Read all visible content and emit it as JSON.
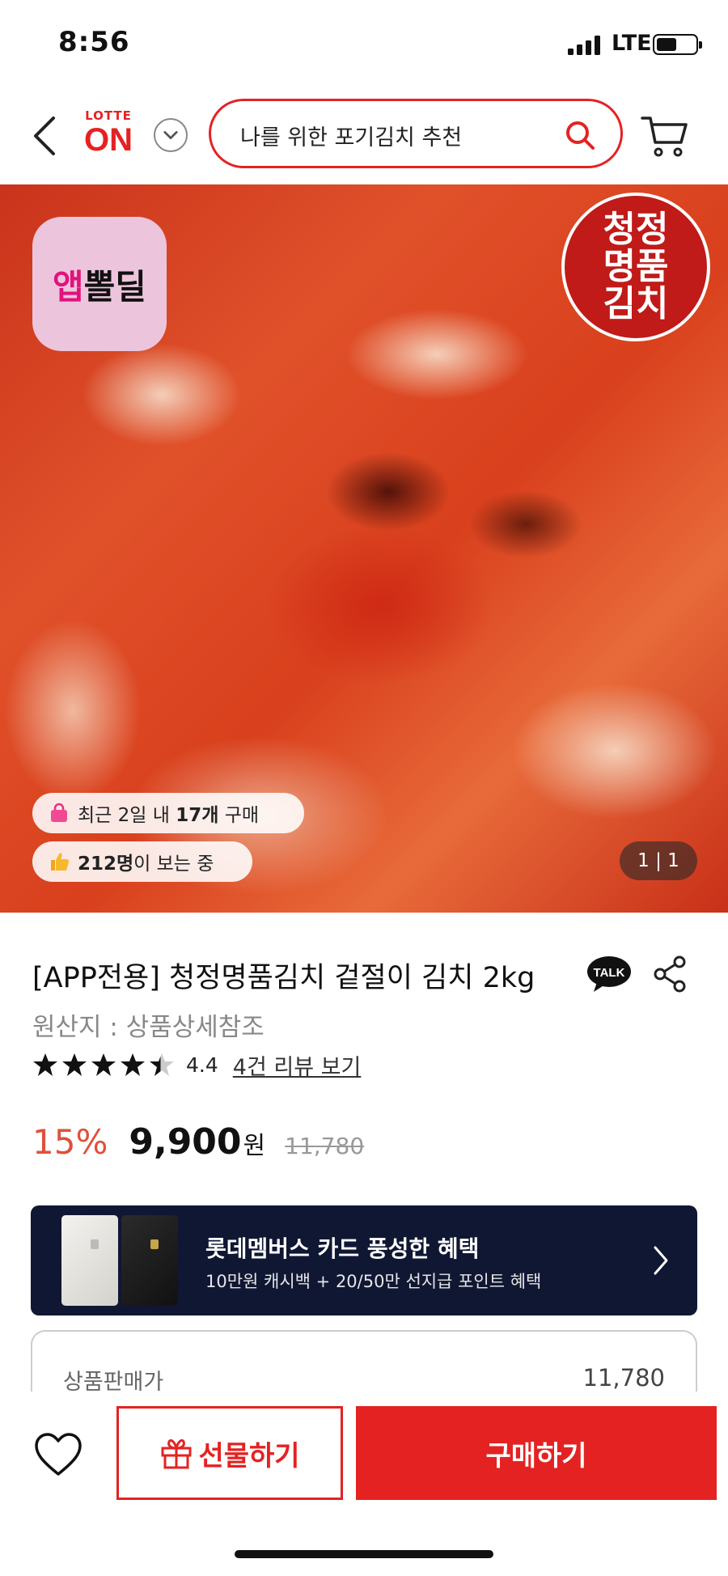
{
  "status_bar": {
    "time": "8:56",
    "network": "LTE"
  },
  "header": {
    "logo_top": "LOTTE",
    "logo_main": "ON",
    "search_text": "나를 위한 포기김치 추천"
  },
  "hero": {
    "badge_accent": "앱",
    "badge_text": "뽈딜",
    "brand_seal_lines": [
      "청정",
      "명품",
      "김치"
    ],
    "recent_purchase_prefix": "최근 2일 내 ",
    "recent_purchase_count": "17개",
    "recent_purchase_suffix": " 구매",
    "viewers_count": "212명",
    "viewers_suffix": "이 보는 중",
    "image_counter": "1 | 1"
  },
  "product": {
    "title": "[APP전용] 청정명품김치 겉절이 김치 2kg",
    "talk_label": "TALK",
    "origin": "원산지 : 상품상세참조",
    "rating": 4.4,
    "rating_text": "4.4",
    "review_link": "4건 리뷰 보기",
    "discount": "15%",
    "sale_price": "9,900",
    "currency": "원",
    "original_price": "11,780"
  },
  "card_banner": {
    "title": "롯데멤버스 카드 풍성한 혜택",
    "subtitle": "10만원 캐시백 + 20/50만 선지급 포인트 혜택"
  },
  "price_detail": {
    "label": "상품판매가",
    "value": "11,780"
  },
  "bottom_bar": {
    "gift_label": "선물하기",
    "buy_label": "구매하기"
  },
  "colors": {
    "accent": "#e42222",
    "discount": "#e0503a",
    "banner_bg": "#0f1733"
  }
}
